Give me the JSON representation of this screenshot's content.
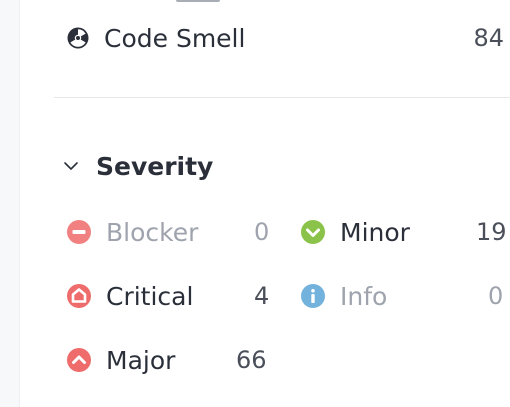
{
  "type_facet": {
    "label": "Code Smell",
    "count": "84",
    "icon": "code-smell-icon"
  },
  "severity": {
    "title": "Severity",
    "expanded": true,
    "items": [
      {
        "label": "Blocker",
        "count": "0",
        "icon": "blocker-icon",
        "color": "#ef6c6c",
        "disabled": true
      },
      {
        "label": "Minor",
        "count": "19",
        "icon": "minor-icon",
        "color": "#8bc34a",
        "disabled": false
      },
      {
        "label": "Critical",
        "count": "4",
        "icon": "critical-icon",
        "color": "#ef6c6c",
        "disabled": false
      },
      {
        "label": "Info",
        "count": "0",
        "icon": "info-icon",
        "color": "#5aa5d6",
        "disabled": true
      },
      {
        "label": "Major",
        "count": "66",
        "icon": "major-icon",
        "color": "#ef6c6c",
        "disabled": false
      }
    ]
  }
}
